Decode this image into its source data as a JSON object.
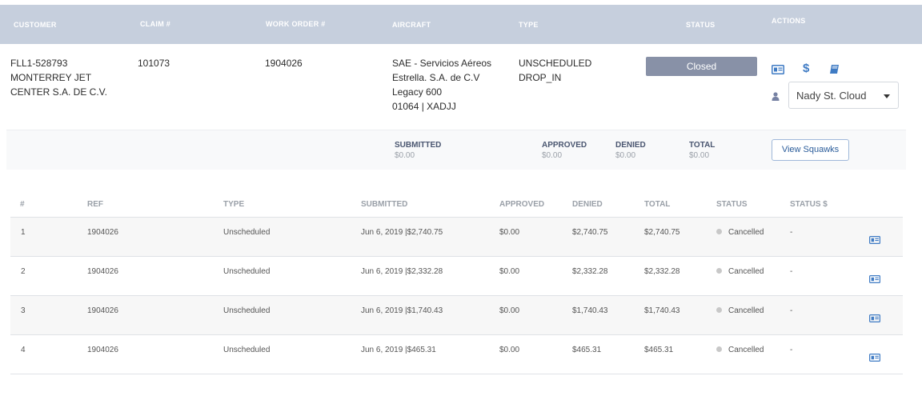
{
  "header": {
    "customer": "CUSTOMER",
    "claim": "CLAIM #",
    "work_order": "WORK ORDER #",
    "aircraft": "AIRCRAFT",
    "type": "TYPE",
    "status": "STATUS",
    "actions": "ACTIONS"
  },
  "claim": {
    "customer": "FLL1-528793\nMONTERREY JET\nCENTER S.A. DE C.V.",
    "claim_number": "101073",
    "work_order": "1904026",
    "aircraft": "SAE - Servicios Aéreos\nEstrella. S.A. de C.V\nLegacy 600\n01064 | XADJJ",
    "type": "UNSCHEDULED\nDROP_IN",
    "status": "Closed",
    "assignee": "Nady St. Cloud"
  },
  "icons": {
    "details": "id-card-icon",
    "money": "dollar-icon",
    "book": "book-icon",
    "person": "person-icon",
    "caret": "chevron-down-icon"
  },
  "summary": {
    "submitted_label": "SUBMITTED",
    "submitted_value": "$0.00",
    "approved_label": "APPROVED",
    "approved_value": "$0.00",
    "denied_label": "DENIED",
    "denied_value": "$0.00",
    "total_label": "TOTAL",
    "total_value": "$0.00",
    "view_button": "View Squawks"
  },
  "table": {
    "columns": [
      "#",
      "REF",
      "TYPE",
      "SUBMITTED",
      "APPROVED",
      "DENIED",
      "TOTAL",
      "STATUS",
      "STATUS $"
    ],
    "rows": [
      {
        "num": "1",
        "ref": "1904026",
        "type": "Unscheduled",
        "submitted": "Jun 6, 2019 |$2,740.75",
        "approved": "$0.00",
        "denied": "$2,740.75",
        "total": "$2,740.75",
        "status": "Cancelled",
        "status_amount": "-"
      },
      {
        "num": "2",
        "ref": "1904026",
        "type": "Unscheduled",
        "submitted": "Jun 6, 2019 |$2,332.28",
        "approved": "$0.00",
        "denied": "$2,332.28",
        "total": "$2,332.28",
        "status": "Cancelled",
        "status_amount": "-"
      },
      {
        "num": "3",
        "ref": "1904026",
        "type": "Unscheduled",
        "submitted": "Jun 6, 2019 |$1,740.43",
        "approved": "$0.00",
        "denied": "$1,740.43",
        "total": "$1,740.43",
        "status": "Cancelled",
        "status_amount": "-"
      },
      {
        "num": "4",
        "ref": "1904026",
        "type": "Unscheduled",
        "submitted": "Jun 6, 2019 |$465.31",
        "approved": "$0.00",
        "denied": "$465.31",
        "total": "$465.31",
        "status": "Cancelled",
        "status_amount": "-"
      }
    ]
  },
  "colors": {
    "header_bg": "#c6cfdd",
    "status_closed": "#8891a7",
    "accent": "#3f7bc4",
    "status_dot": "#c8c8c8"
  }
}
